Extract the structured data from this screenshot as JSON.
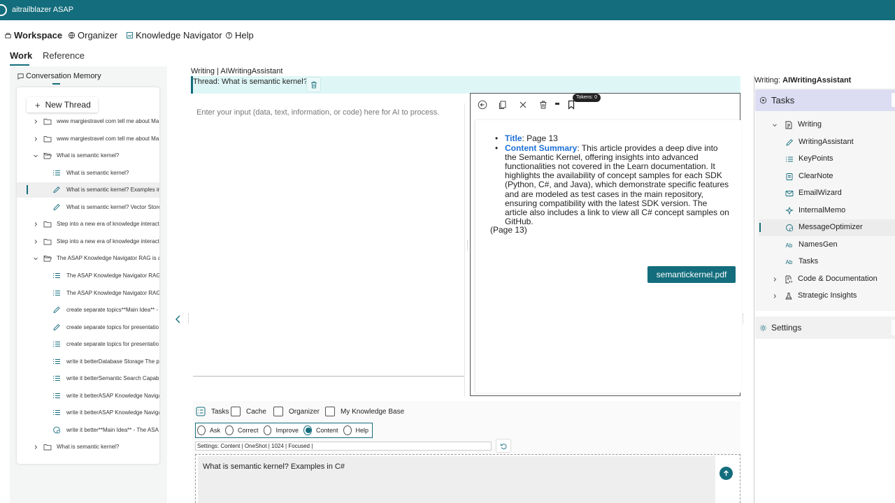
{
  "app": {
    "title": "aitrailblazer ASAP"
  },
  "nav": {
    "workspace": "Workspace",
    "organizer": "Organizer",
    "knowledge_navigator": "Knowledge Navigator",
    "help": "Help"
  },
  "tabs": {
    "work": "Work",
    "reference": "Reference"
  },
  "left": {
    "title": "Conversation Memory",
    "new_thread": "New Thread",
    "items": [
      {
        "label": "www margiestravel com tell me about Ma",
        "kind": "folder",
        "level": 0,
        "expanded": false
      },
      {
        "label": "www margiestravel com tell me about Ma",
        "kind": "folder",
        "level": 0,
        "expanded": false
      },
      {
        "label": "What is semantic kernel?",
        "kind": "folder-open",
        "level": 0,
        "expanded": true
      },
      {
        "label": "What is semantic kernel?",
        "kind": "list",
        "level": 1
      },
      {
        "label": "What is semantic kernel? Examples in",
        "kind": "pencil",
        "level": 1,
        "selected": true
      },
      {
        "label": "What is semantic kernel? Vector Store",
        "kind": "pencil",
        "level": 1
      },
      {
        "label": "Step into a new era of knowledge interact",
        "kind": "folder",
        "level": 0,
        "expanded": false
      },
      {
        "label": "Step into a new era of knowledge interact",
        "kind": "folder",
        "level": 0,
        "expanded": false
      },
      {
        "label": "The ASAP Knowledge Navigator RAG is a g",
        "kind": "folder-open",
        "level": 0,
        "expanded": true
      },
      {
        "label": "The ASAP Knowledge Navigator RAG is",
        "kind": "list",
        "level": 1
      },
      {
        "label": "The ASAP Knowledge Navigator RAG is",
        "kind": "list",
        "level": 1
      },
      {
        "label": "create separate topics**Main Idea** -",
        "kind": "pencil",
        "level": 1
      },
      {
        "label": "create separate topics for presentatio",
        "kind": "pencil",
        "level": 1
      },
      {
        "label": "create separate topics for presentatio",
        "kind": "list",
        "level": 1
      },
      {
        "label": "write it betterDatabase Storage The p",
        "kind": "list",
        "level": 1
      },
      {
        "label": "write it betterSemantic Search Capab",
        "kind": "list",
        "level": 1
      },
      {
        "label": "write it betterASAP Knowledge Naviga",
        "kind": "list",
        "level": 1
      },
      {
        "label": "write it betterASAP Knowledge Naviga",
        "kind": "list",
        "level": 1
      },
      {
        "label": "write it better**Main Idea** - The ASA",
        "kind": "gear",
        "level": 1
      },
      {
        "label": "What is semantic kernel?",
        "kind": "folder",
        "level": 0,
        "expanded": false
      }
    ]
  },
  "center": {
    "title": "Writing | AIWritingAssistant",
    "thread_label": "Thread: What is semantic kernel?",
    "input_placeholder": "Enter your input (data, text, information, or code) here for AI to process.",
    "tokens": "Tokens: 0",
    "output": {
      "title_key": "Title",
      "title_value": ": Page 13",
      "summary_key": "Content Summary",
      "summary_value": ": This article provides a deep dive into the Semantic Kernel, offering insights into advanced functionalities not covered in the Learn documentation. It highlights the availability of concept samples for each SDK (Python, C#, and Java), which demonstrate specific features and are modeled as test cases in the main repository, ensuring compatibility with the latest SDK version. The article also includes a link to view all C# concept samples on GitHub.",
      "page_note": "(Page 13)",
      "file_button": "semantickernel.pdf"
    },
    "checkboxes": {
      "tasks": "Tasks",
      "cache": "Cache",
      "organizer": "Organizer",
      "kb": "My Knowledge Base"
    },
    "modes": [
      {
        "label": "Ask",
        "selected": false
      },
      {
        "label": "Correct",
        "selected": false
      },
      {
        "label": "Improve",
        "selected": false
      },
      {
        "label": "Content",
        "selected": true
      },
      {
        "label": "Help",
        "selected": false
      }
    ],
    "settings_line": "Settings:   Content |   OneShot |   1024 |   Focused |",
    "prompt": "What is semantic kernel? Examples in C#"
  },
  "right": {
    "title_prefix": "Writing: ",
    "title_name": "AIWritingAssistant",
    "tasks_header": "Tasks",
    "settings": "Settings",
    "items": [
      {
        "label": "Writing",
        "icon": "doc-edit-icon",
        "chevron": "down",
        "level": 0
      },
      {
        "label": "WritingAssistant",
        "icon": "pencil-icon",
        "level": 1
      },
      {
        "label": "KeyPoints",
        "icon": "list-icon",
        "level": 1
      },
      {
        "label": "ClearNote",
        "icon": "note-icon",
        "level": 1
      },
      {
        "label": "EmailWizard",
        "icon": "mail-icon",
        "level": 1
      },
      {
        "label": "InternalMemo",
        "icon": "sparkle-icon",
        "level": 1
      },
      {
        "label": "MessageOptimizer",
        "icon": "optimize-icon",
        "level": 1,
        "selected": true
      },
      {
        "label": "NamesGen",
        "icon": "text-ab-icon",
        "level": 1
      },
      {
        "label": "Tasks",
        "icon": "text-ab-icon",
        "level": 1
      },
      {
        "label": "Code & Documentation",
        "icon": "code-doc-icon",
        "chevron": "right",
        "level": 0
      },
      {
        "label": "Strategic Insights",
        "icon": "insight-icon",
        "chevron": "right",
        "level": 0
      }
    ]
  },
  "colors": {
    "primary": "#136d7c",
    "link": "#1b6fd6",
    "tasks_header": "#dcdcf3",
    "thread_bar": "#dff6f6"
  }
}
